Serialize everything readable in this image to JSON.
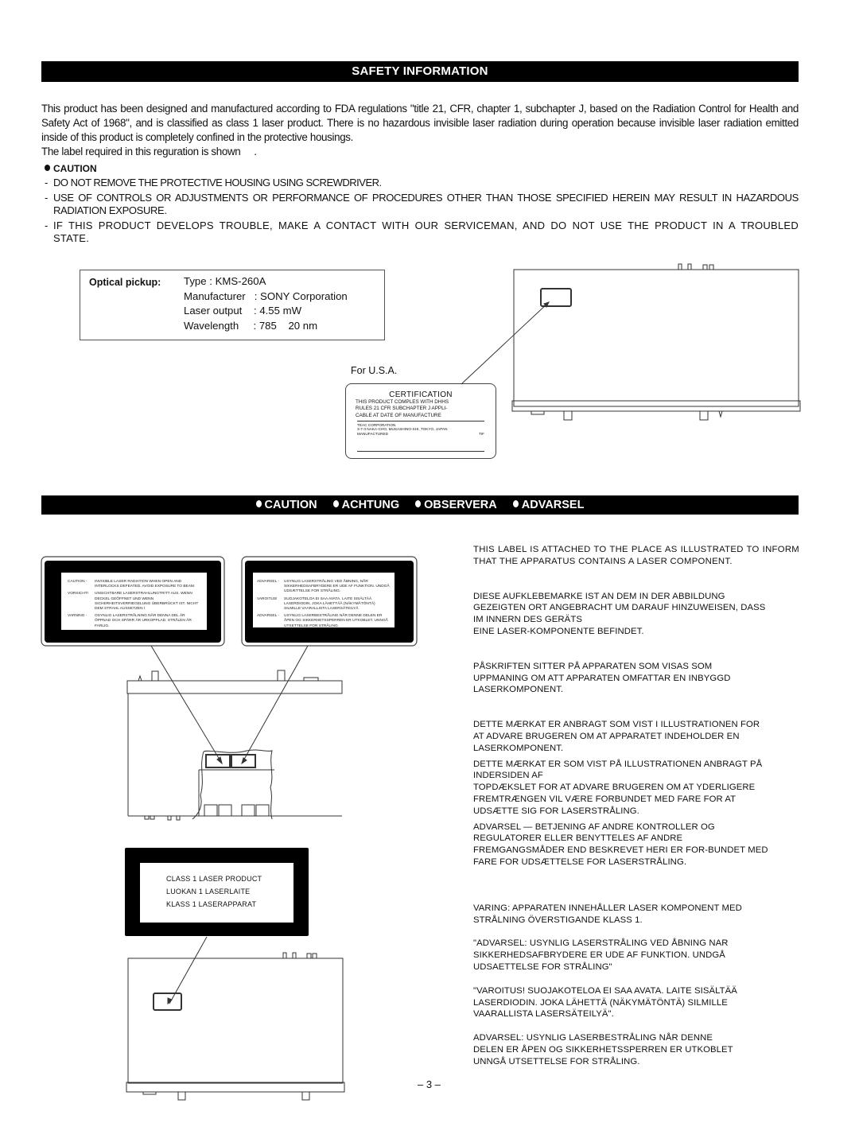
{
  "safety": {
    "title": "SAFETY INFORMATION",
    "intro": [
      "This product has been designed and manufactured according to FDA regulations \"title 21, CFR, chapter 1, subchapter J, based on the Radiation Control for Health and Safety Act of 1968\", and is classified as class 1 laser product. There is no hazardous invisible laser radiation during operation because invisible laser radiation emitted inside of this product is completely confined in the protective housings.",
      "The label required in this reguration is shown     ."
    ],
    "caution_heading": "CAUTION",
    "caution_items": [
      "DO NOT REMOVE THE PROTECTIVE HOUSING USING SCREWDRIVER.",
      "USE OF CONTROLS OR ADJUSTMENTS OR PERFORMANCE OF PROCEDURES OTHER THAN THOSE SPECIFIED HEREIN MAY RESULT IN HAZARDOUS RADIATION EXPOSURE.",
      "IF THIS PRODUCT DEVELOPS TROUBLE, MAKE A CONTACT WITH OUR SERVICEMAN, AND DO NOT USE THE PRODUCT IN A TROUBLED STATE."
    ]
  },
  "optical_pickup": {
    "label": "Optical pickup:",
    "rows": [
      {
        "key": "Type",
        "sep": " : ",
        "value": "KMS-260A"
      },
      {
        "key": "Manufacturer",
        "sep": "   : ",
        "value": "SONY Corporation"
      },
      {
        "key": "Laser output",
        "sep": "    : ",
        "value": "4.55 mW"
      },
      {
        "key": "Wavelength",
        "sep": "     : ",
        "value": "785    20 nm"
      }
    ]
  },
  "certification": {
    "region": "For U.S.A.",
    "title": "CERTIFICATION",
    "body": [
      "THIS PRODUCT COMPLES WITH DHHS",
      "RULES 21 CFR SUBCHAPTER J APPLI-",
      "CABLE AT DATE OF MANUFACTURE"
    ],
    "company": "TEAC CORPORATION",
    "address": "3-7-3 NAKA-CHO, MUSASHINO-SHI, TOKYO, JAPAN",
    "manufactured": "MANUFACTURED",
    "tif": "TIF"
  },
  "warnings_banner": {
    "items": [
      "CAUTION",
      "ACHTUNG",
      "OBSERVERA",
      "ADVARSEL"
    ]
  },
  "label_left": [
    {
      "key": "CAUTION -",
      "text": "INVISIBLE LASER RADIATION WHEN OPEN AND INTERLOCKS DEFEATED. AVOID EXPOSURE TO BEAM."
    },
    {
      "key": "VORSICHT!",
      "text": "UNSICHTBARE LASERSTRAHLUNGTRITT AUS. WENN DECKEL GEÖFFNET UND WENN SICHERHEITSVERRIEGELUNG ÜBERBRÜCKT IST. NICHT DEM STRAHL AUSSETZEN !"
    },
    {
      "key": "VARNING -",
      "text": "OSYNLIG LASERSTRÅLNING NÄR DENNA DEL ÄR ÖPPNAD OCH SPÄRR ÄR URKOPPLAD. STRÅLEN ÄR FARLIG."
    }
  ],
  "label_right": [
    {
      "key": "ADVARSEL -",
      "text": "USYNLIG LASERSTRÅLING VED ÅBNING, NÅR SIKKERHEDSAFBRYDERE ER UDE AF FUNKTION. UNDGÅ UDSÆTTELSE FOR STRÅLING."
    },
    {
      "key": "VAROITUS!",
      "text": "SUOJAKOTELOA EI SAA AVATA. LAITE SISÄLTÄÄ LASERDIODIN, JOKA LÄHETTÄÄ (NÄKYMÄTÖNTÄ) SILMILLE VAARALLISTA LASERSÄTEILYÄ."
    },
    {
      "key": "ADVARSEL -",
      "text": "USYNLIG LASERBESTRÅLING NÅR DENNE DELEN ER ÅPEN OG SIKKERHETSSPERREN ER UTKOBLET. UNNGÅ UTSETTELSE FOR STRÅLING."
    }
  ],
  "class_label": [
    "CLASS 1 LASER PRODUCT",
    "LUOKAN 1 LASERLAITE",
    "KLASS 1 LASERAPPARAT"
  ],
  "right_paragraphs": [
    "THIS LABEL IS ATTACHED TO THE PLACE AS ILLUSTRATED TO INFORM THAT THE APPARATUS CONTAINS A LASER COMPONENT.",
    "DIESE AUFKLEBEMARKE IST AN DEM IN DER ABBILDUNG\nGEZEIGTEN ORT ANGEBRACHT UM DARAUF HINZUWEISEN, DASS\nIM INNERN DES GERÄTS\nEINE LASER-KOMPONENTE BEFINDET.",
    "PÅSKRIFTEN SITTER PÅ APPARATEN SOM VISAS SOM\nUPPMANING OM ATT APPARATEN OMFATTAR EN INBYGGD\nLASERKOMPONENT.",
    "DETTE MÆRKAT ER ANBRAGT SOM VIST I ILLUSTRATIONEN FOR\nAT ADVARE BRUGEREN OM AT APPARATET INDEHOLDER EN\nLASERKOMPONENT.",
    "DETTE MÆRKAT ER SOM VIST PÅ ILLUSTRATIONEN ANBRAGT PÅ\nINDERSIDEN AF\nTOPDÆKSLET FOR AT ADVARE BRUGEREN OM AT YDERLIGERE\nFREMTRÆNGEN VIL VÆRE FORBUNDET MED FARE FOR AT\nUDSÆTTE SIG FOR LASERSTRÅLING.",
    "ADVARSEL — BETJENING AF ANDRE KONTROLLER OG\nREGULATORER ELLER BENYTTELES AF ANDRE\nFREMGANGSMÅDER END BESKREVET HERI ER FOR-BUNDET MED\nFARE FOR UDSÆTTELSE FOR LASERSTRÅLING.",
    "VARING: APPARATEN INNEHÅLLER LASER KOMPONENT MED\nSTRÅLNING ÖVERSTIGANDE KLASS 1.",
    "\"ADVARSEL: USYNLIG LASERSTRÅLING VED ÅBNING NAR\nSIKKERHEDSAFBRYDERE ER UDE AF FUNKTION. UNDGÅ\nUDSAETTELSE FOR STRÅLING\"",
    "\"VAROITUS! SUOJAKOTELOA EI SAA AVATA. LAITE SISÄLTÄÄ\nLASERDIODIN. JOKA LÄHETTÄ (NÄKYMÄTÖNTÄ) SILMILLE\nVAARALLISTA LASERSÄTEILYÄ\".",
    "ADVARSEL: USYNLIG LASERBESTRÅLING NÅR DENNE\nDELEN ER ÅPEN OG SIKKERHETSSPERREN ER UTKOBLET\nUNNGÅ UTSETTELSE FOR STRÅLING."
  ],
  "page_number": "– 3 –"
}
